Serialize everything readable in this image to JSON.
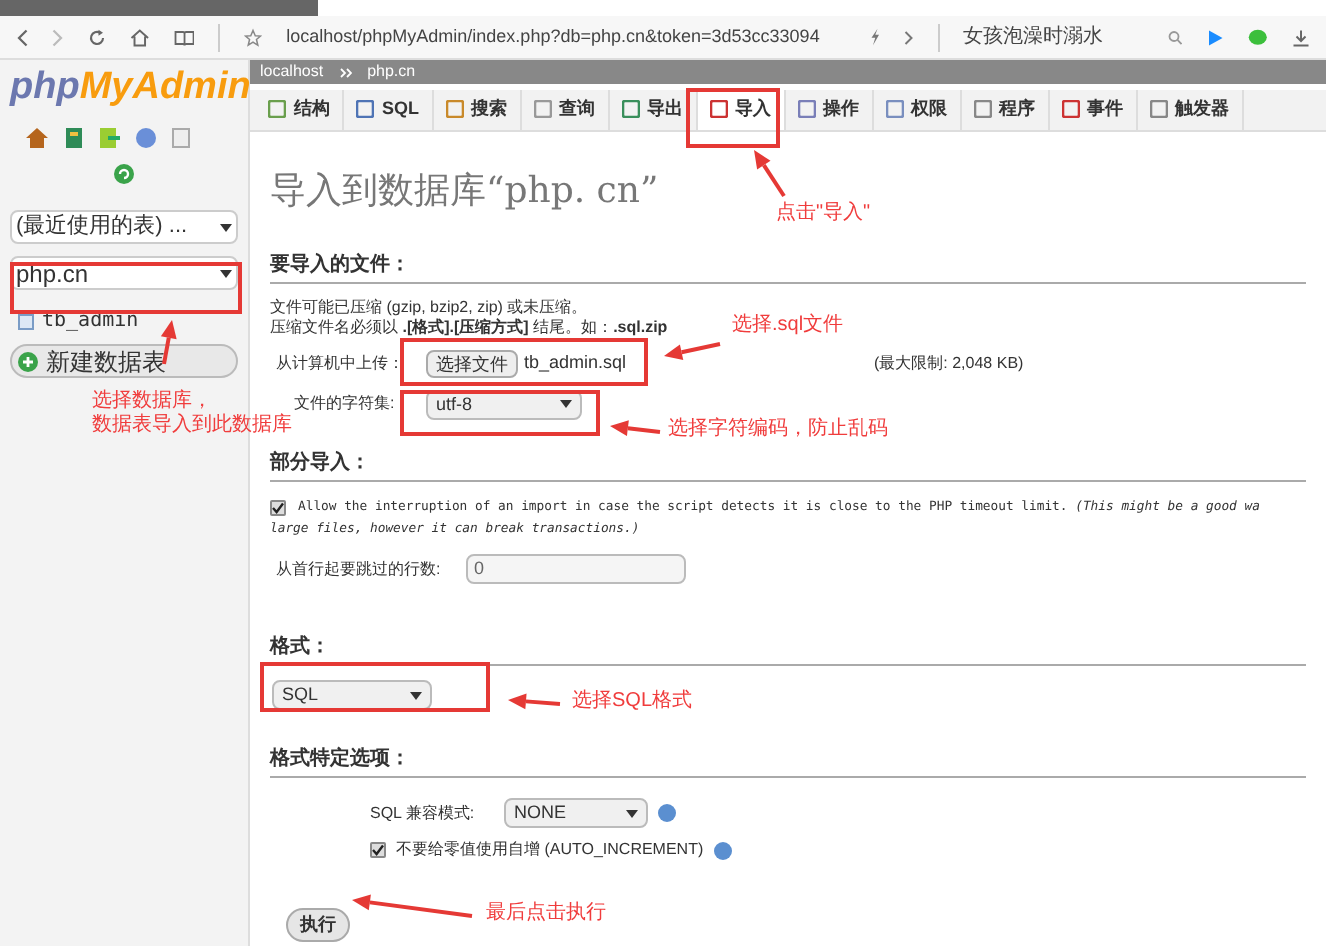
{
  "browser": {
    "url": "localhost/phpMyAdmin/index.php?db=php.cn&token=3d53cc33094",
    "search": "女孩泡澡时溺水",
    "loading": {
      "level": 0.24
    }
  },
  "sidebar": {
    "logo_php": "php",
    "logo_rest": "MyAdmin",
    "recent": "(最近使用的表) ...",
    "database": "php.cn",
    "tables": [
      "tb_admin"
    ],
    "new_table": "新建数据表"
  },
  "breadcrumb": [
    "localhost",
    "php.cn"
  ],
  "tabs": [
    {
      "label": "结构",
      "selected": false
    },
    {
      "label": "SQL",
      "selected": false
    },
    {
      "label": "搜索",
      "selected": false
    },
    {
      "label": "查询",
      "selected": false
    },
    {
      "label": "导出",
      "selected": false
    },
    {
      "label": "导入",
      "selected": true
    },
    {
      "label": "操作",
      "selected": false
    },
    {
      "label": "权限",
      "selected": false
    },
    {
      "label": "程序",
      "selected": false
    },
    {
      "label": "事件",
      "selected": false
    },
    {
      "label": "触发器",
      "selected": false
    }
  ],
  "heading": "导入到数据库“php. cn”",
  "file_section": {
    "title": "要导入的文件：",
    "note_1": "文件可能已压缩 (gzip, bzip2, zip) 或未压缩。",
    "note_2": "压缩文件名必须以 **.[格式].[压缩方式]** 结尾。如：**.sql.zip**",
    "upload_label": "从计算机中上传：",
    "choose_button": "选择文件",
    "file_name": "tb_admin.sql",
    "max_size": "(最大限制: 2,048 KB)",
    "charset_label": "文件的字符集:",
    "charset": "utf-8"
  },
  "partial_section": {
    "title": "部分导入：",
    "allow_interrupt": {
      "checked": true,
      "label": "Allow the interruption of an import in case the script detects it is close to the PHP timeout limit. *(This might be a good wa*",
      "continued": "large files, however it can break transactions.)"
    },
    "skip_label": "从首行起要跳过的行数:",
    "skip_value": "0"
  },
  "format_section": {
    "title": "格式：",
    "format": "SQL"
  },
  "options_section": {
    "title": "格式特定选项：",
    "compat_label": "SQL 兼容模式:",
    "compat": "NONE",
    "no_auto_zero": {
      "checked": true,
      "label": "不要给零值使用自增 (AUTO_INCREMENT)"
    }
  },
  "go_button": "执行",
  "annotations": [
    "点击\"导入\"",
    "选择数据库，",
    "数据表导入到此数据库",
    "选择.sql文件",
    "选择字符编码，防止乱码",
    "选择SQL格式",
    "最后点击执行"
  ]
}
